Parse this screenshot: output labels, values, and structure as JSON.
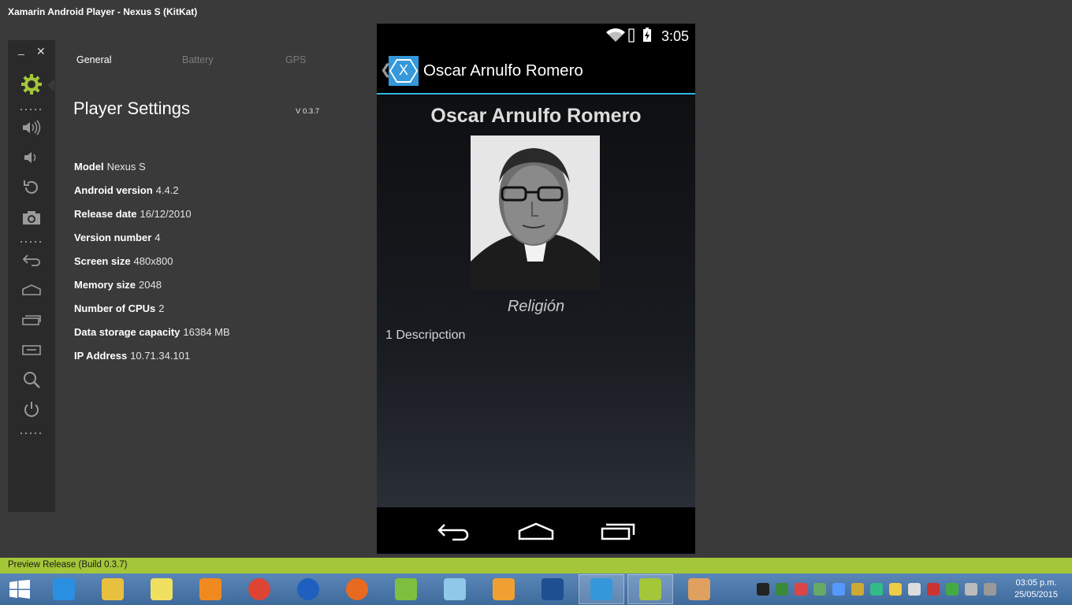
{
  "window": {
    "title": "Xamarin Android Player - Nexus S (KitKat)"
  },
  "window_controls": {
    "minimize": "_",
    "close": "✕"
  },
  "toolbar": {
    "icons": [
      "gear-icon",
      "volume-up-icon",
      "volume-down-icon",
      "rotate-icon",
      "camera-icon",
      "back-icon",
      "home-icon",
      "recents-icon",
      "menu-icon",
      "search-icon",
      "power-icon"
    ],
    "accent_color": "#a4c639"
  },
  "tabs": [
    {
      "label": "General",
      "active": true
    },
    {
      "label": "Battery",
      "active": false
    },
    {
      "label": "GPS",
      "active": false
    }
  ],
  "settings": {
    "title_part1": "Player",
    "title_part2": "Settings",
    "version": "V 0.3.7",
    "properties": [
      {
        "key": "Model",
        "value": "Nexus S"
      },
      {
        "key": "Android version",
        "value": "4.4.2"
      },
      {
        "key": "Release date",
        "value": "16/12/2010"
      },
      {
        "key": "Version number",
        "value": "4"
      },
      {
        "key": "Screen size",
        "value": "480x800"
      },
      {
        "key": "Memory size",
        "value": "2048"
      },
      {
        "key": "Number of CPUs",
        "value": "2"
      },
      {
        "key": "Data storage capacity",
        "value": "16384 MB"
      },
      {
        "key": "IP Address",
        "value": "10.71.34.101"
      }
    ]
  },
  "phone": {
    "status": {
      "time": "3:05"
    },
    "action_bar": {
      "caret": "❮",
      "logo_letter": "X",
      "title": "Oscar Arnulfo Romero",
      "underline_color": "#33b5e5"
    },
    "content": {
      "name": "Oscar Arnulfo Romero",
      "subtitle": "Religión",
      "description": "1 Descripction"
    }
  },
  "preview_bar": {
    "text": "Preview Release (Build 0.3.7)"
  },
  "taskbar": {
    "apps": [
      "internet-explorer",
      "file-explorer",
      "sticky-notes",
      "media-player",
      "chrome",
      "app-blue",
      "firefox",
      "notepad-plus",
      "app-glass",
      "sublime-text",
      "powershell",
      "xamarin",
      "android-player",
      "paint"
    ],
    "open_apps": [
      "xamarin",
      "android-player"
    ],
    "clock_time": "03:05 p.m.",
    "clock_date": "25/05/2015"
  }
}
